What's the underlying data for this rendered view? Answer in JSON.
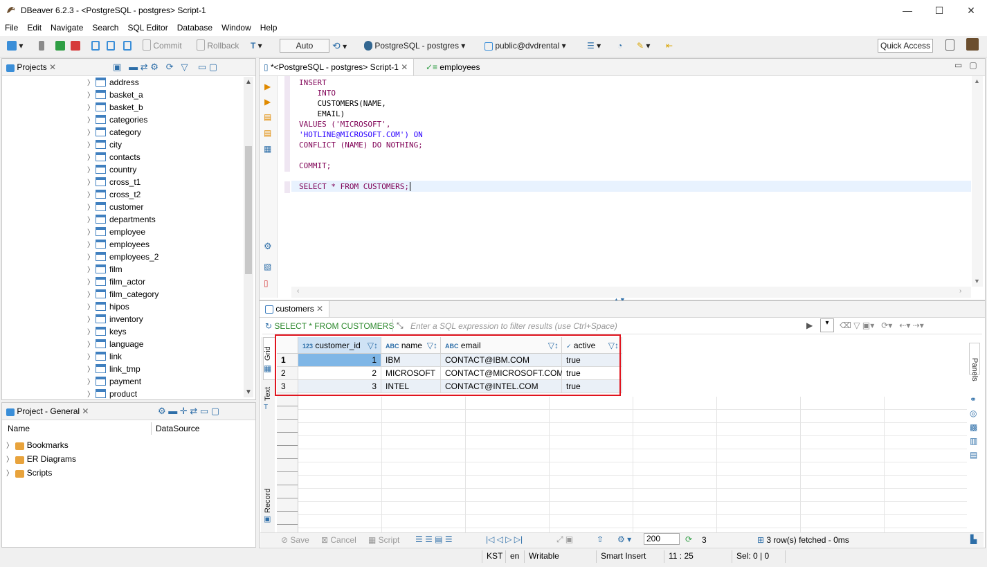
{
  "window": {
    "title": "DBeaver 6.2.3 - <PostgreSQL - postgres> Script-1"
  },
  "menu": [
    "File",
    "Edit",
    "Navigate",
    "Search",
    "SQL Editor",
    "Database",
    "Window",
    "Help"
  ],
  "toolbar": {
    "commit": "Commit",
    "rollback": "Rollback",
    "mode": "Auto",
    "connection": "PostgreSQL - postgres",
    "schema": "public@dvdrental",
    "quick_access": "Quick Access"
  },
  "projects_panel": {
    "tab": "Projects",
    "tables": [
      "address",
      "basket_a",
      "basket_b",
      "categories",
      "category",
      "city",
      "contacts",
      "country",
      "cross_t1",
      "cross_t2",
      "customer",
      "departments",
      "employee",
      "employees",
      "employees_2",
      "film",
      "film_actor",
      "film_category",
      "hipos",
      "inventory",
      "keys",
      "language",
      "link",
      "link_tmp",
      "payment",
      "product"
    ]
  },
  "project_general": {
    "tab": "Project - General",
    "col_name": "Name",
    "col_datasource": "DataSource",
    "items": [
      "Bookmarks",
      "ER Diagrams",
      "Scripts"
    ]
  },
  "editor": {
    "tab_active": "*<PostgreSQL - postgres> Script-1",
    "tab_other": "employees",
    "lines": [
      "INSERT",
      "    INTO",
      "    CUSTOMERS(NAME,",
      "    EMAIL)",
      "VALUES ('MICROSOFT',",
      "'HOTLINE@MICROSOFT.COM') ON",
      "CONFLICT (NAME) DO NOTHING;",
      "",
      "COMMIT;",
      "",
      "SELECT * FROM CUSTOMERS;"
    ]
  },
  "results": {
    "tab": "customers",
    "query": "SELECT * FROM CUSTOMERS",
    "filter_placeholder": "Enter a SQL expression to filter results (use Ctrl+Space)",
    "side_tabs": {
      "grid": "Grid",
      "text": "Text",
      "record": "Record",
      "panels": "Panels"
    },
    "columns": [
      {
        "type": "123",
        "name": "customer_id"
      },
      {
        "type": "ABC",
        "name": "name"
      },
      {
        "type": "ABC",
        "name": "email"
      },
      {
        "type": "✓",
        "name": "active"
      }
    ],
    "rows": [
      {
        "num": "1",
        "customer_id": "1",
        "name": "IBM",
        "email": "CONTACT@IBM.COM",
        "active": "true"
      },
      {
        "num": "2",
        "customer_id": "2",
        "name": "MICROSOFT",
        "email": "CONTACT@MICROSOFT.COM",
        "active": "true"
      },
      {
        "num": "3",
        "customer_id": "3",
        "name": "INTEL",
        "email": "CONTACT@INTEL.COM",
        "active": "true"
      }
    ],
    "bottom": {
      "save": "Save",
      "cancel": "Cancel",
      "script": "Script",
      "fetch_size": "200",
      "row_count": "3",
      "fetched": "3 row(s) fetched - 0ms"
    }
  },
  "statusbar": {
    "tz": "KST",
    "lang": "en",
    "mode": "Writable",
    "insert": "Smart Insert",
    "pos": "11 : 25",
    "sel": "Sel: 0 | 0"
  },
  "colors": {
    "accent": "#3f7fbf",
    "highlight_border": "#e0141e",
    "selected_cell": "#7fb6e6",
    "keyword": "#7f0055",
    "string": "#2a00ff"
  }
}
